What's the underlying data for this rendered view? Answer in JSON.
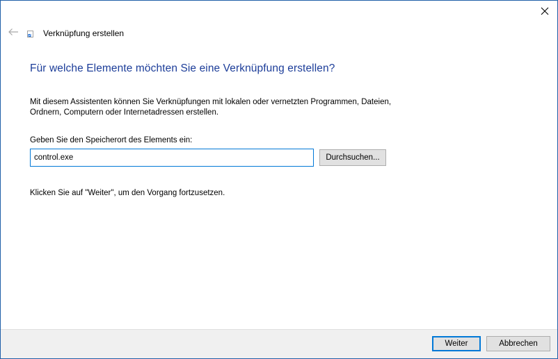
{
  "window": {
    "close_symbol": "✕",
    "back_icon": "arrow-left-icon",
    "wizard_icon": "shortcut-icon",
    "title": "Verknüpfung erstellen"
  },
  "main": {
    "heading": "Für welche Elemente möchten Sie eine Verknüpfung erstellen?",
    "description": "Mit diesem Assistenten können Sie Verknüpfungen mit lokalen oder vernetzten Programmen, Dateien, Ordnern, Computern oder Internetadressen erstellen.",
    "location_label": "Geben Sie den Speicherort des Elements ein:",
    "location_value": "control.exe",
    "browse_label": "Durchsuchen...",
    "hint": "Klicken Sie auf \"Weiter\", um den Vorgang fortzusetzen."
  },
  "footer": {
    "next_label": "Weiter",
    "cancel_label": "Abbrechen"
  },
  "colors": {
    "heading": "#1c3d99",
    "accent": "#0078d7",
    "window_border": "#1f5fa8",
    "footer_bg": "#f0f0f0",
    "button_bg": "#e1e1e1"
  }
}
